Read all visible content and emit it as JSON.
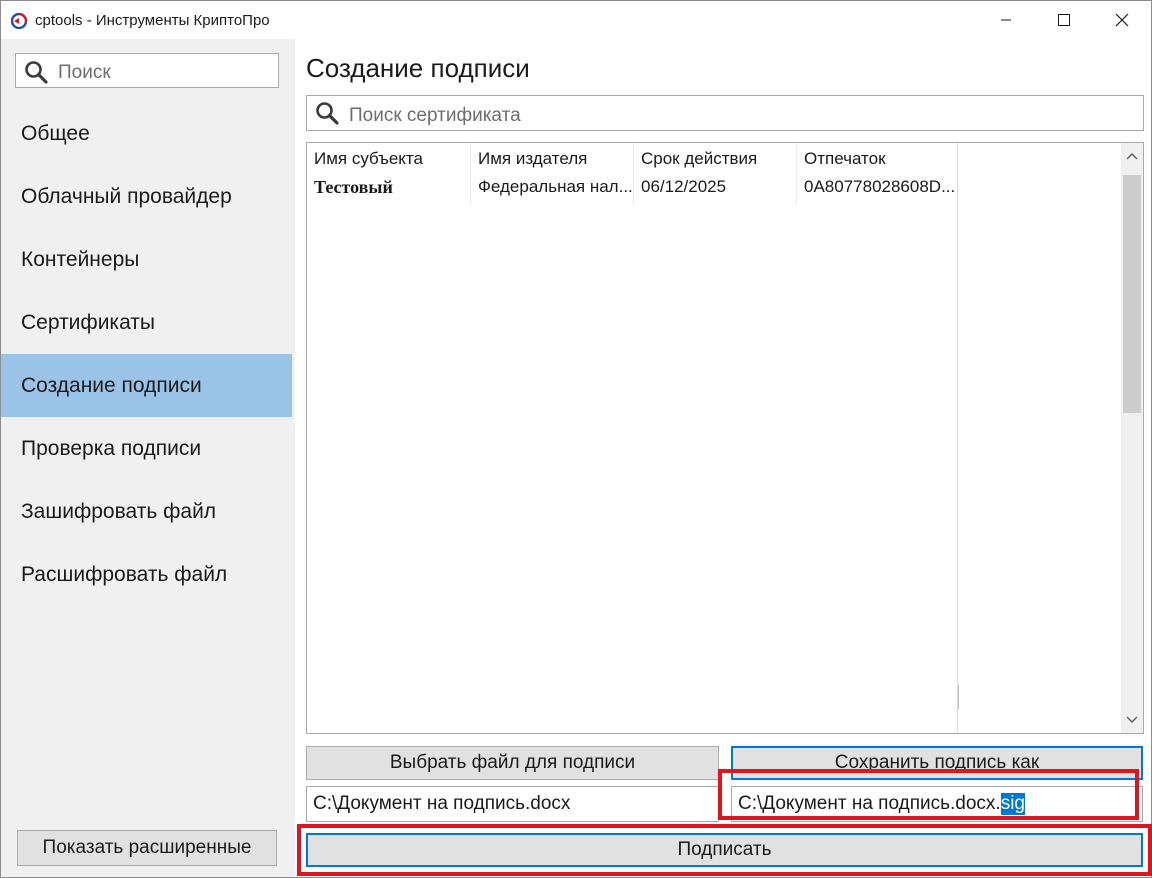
{
  "window": {
    "title": "cptools - Инструменты КриптоПро",
    "controls": [
      "minimize-icon",
      "maximize-icon",
      "close-icon"
    ]
  },
  "sidebar": {
    "search_placeholder": "Поиск",
    "items": [
      {
        "label": "Общее",
        "selected": false
      },
      {
        "label": "Облачный провайдер",
        "selected": false
      },
      {
        "label": "Контейнеры",
        "selected": false
      },
      {
        "label": "Сертификаты",
        "selected": false
      },
      {
        "label": "Создание подписи",
        "selected": true
      },
      {
        "label": "Проверка подписи",
        "selected": false
      },
      {
        "label": "Зашифровать файл",
        "selected": false
      },
      {
        "label": "Расшифровать файл",
        "selected": false
      }
    ],
    "show_advanced_label": "Показать расширенные"
  },
  "main": {
    "title": "Создание подписи",
    "cert_search_placeholder": "Поиск сертификата",
    "table": {
      "columns": [
        "Имя субъекта",
        "Имя издателя",
        "Срок действия",
        "Отпечаток"
      ],
      "rows": [
        [
          "Тестовый",
          "Федеральная нал...",
          "06/12/2025",
          "0A80778028608D..."
        ]
      ]
    },
    "choose_file_label": "Выбрать файл для подписи",
    "save_as_label": "Сохранить подпись как",
    "source_path": "C:\\Документ на подпись.docx",
    "target_path_prefix": "C:\\Документ на подпись.docx.",
    "target_path_selected": "sig",
    "sign_label": "Подписать"
  },
  "colors": {
    "selected_nav": "#99c4e8",
    "focus_border": "#0078d7",
    "highlight_box": "#e0141e"
  }
}
